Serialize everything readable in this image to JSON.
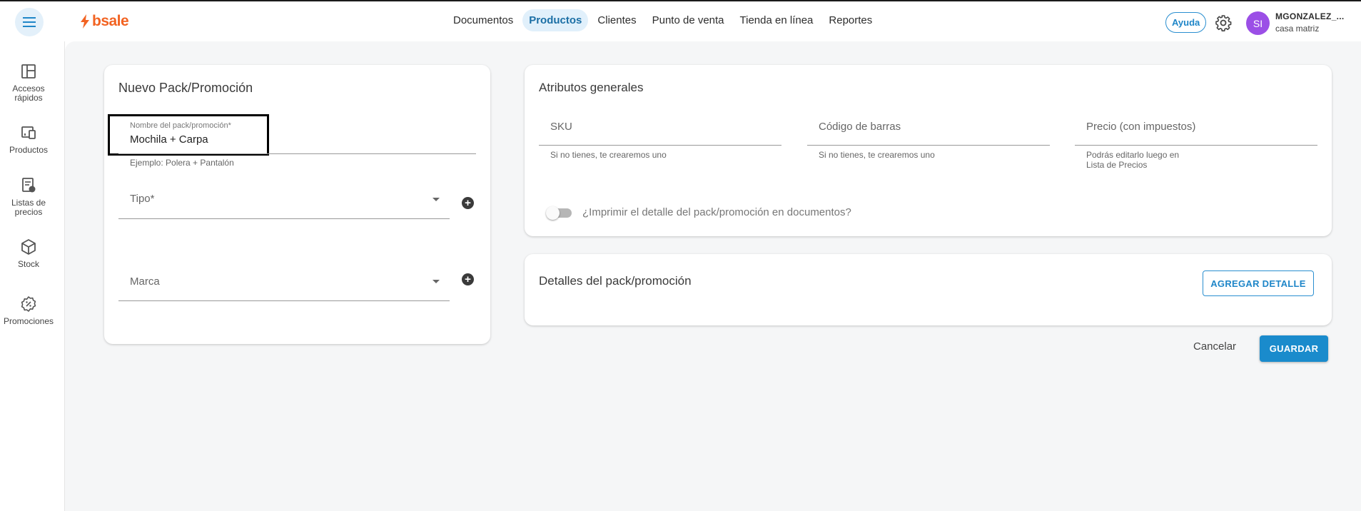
{
  "header": {
    "logo_text": "bsale",
    "nav": [
      "Documentos",
      "Productos",
      "Clientes",
      "Punto de venta",
      "Tienda en línea",
      "Reportes"
    ],
    "active_nav": "Productos",
    "help_label": "Ayuda",
    "avatar_initials": "SI",
    "user_name": "MGONZALEZ_...",
    "user_branch": "casa matriz"
  },
  "sidebar": {
    "items": [
      {
        "label_line1": "Accesos",
        "label_line2": "rápidos",
        "icon": "dashboard-icon"
      },
      {
        "label_line1": "Productos",
        "label_line2": "",
        "icon": "products-icon"
      },
      {
        "label_line1": "Listas de",
        "label_line2": "precios",
        "icon": "price-list-icon"
      },
      {
        "label_line1": "Stock",
        "label_line2": "",
        "icon": "cube-icon"
      },
      {
        "label_line1": "Promociones",
        "label_line2": "",
        "icon": "promotion-icon"
      }
    ]
  },
  "form": {
    "title": "Nuevo Pack/Promoción",
    "name_label": "Nombre del pack/promoción*",
    "name_value": "Mochila + Carpa",
    "name_hint": "Ejemplo: Polera + Pantalón",
    "type_label": "Tipo*",
    "brand_label": "Marca"
  },
  "attributes": {
    "title": "Atributos generales",
    "sku_label": "SKU",
    "sku_hint": "Si no tienes, te crearemos uno",
    "barcode_label": "Código de barras",
    "barcode_hint": "Si no tienes, te crearemos uno",
    "price_label": "Precio (con impuestos)",
    "price_hint_line1": "Podrás editarlo luego en",
    "price_hint_line2": "Lista de Precios",
    "print_toggle_label": "¿Imprimir el detalle del pack/promoción en documentos?",
    "print_toggle_on": false
  },
  "details": {
    "title": "Detalles del pack/promoción",
    "add_button": "AGREGAR DETALLE"
  },
  "actions": {
    "cancel": "Cancelar",
    "save": "GUARDAR"
  },
  "colors": {
    "brand": "#f26322",
    "accent": "#1a8bcc",
    "avatar": "#9b4fe6"
  }
}
